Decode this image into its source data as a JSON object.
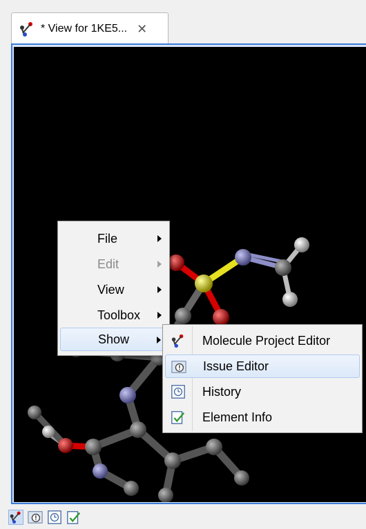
{
  "tab": {
    "title": "* View for 1KE5...",
    "close_glyph": "✕",
    "icon": "molecule-icon"
  },
  "viewer": {
    "description_icon": "3d-molecule-view"
  },
  "context_menu": {
    "items": [
      {
        "label": "File",
        "has_submenu": true,
        "enabled": true
      },
      {
        "label": "Edit",
        "has_submenu": true,
        "enabled": false
      },
      {
        "label": "View",
        "has_submenu": true,
        "enabled": true
      },
      {
        "label": "Toolbox",
        "has_submenu": true,
        "enabled": true
      },
      {
        "label": "Show",
        "has_submenu": true,
        "enabled": true,
        "highlighted": true
      }
    ]
  },
  "show_submenu": {
    "items": [
      {
        "label": "Molecule Project Editor",
        "icon": "molecule-icon"
      },
      {
        "label": "Issue Editor",
        "icon": "issue-icon",
        "highlighted": true
      },
      {
        "label": "History",
        "icon": "history-icon"
      },
      {
        "label": "Element Info",
        "icon": "element-info-icon"
      }
    ]
  },
  "bottom_bar": {
    "icons": [
      "molecule-icon",
      "issue-icon",
      "history-icon",
      "element-info-icon"
    ]
  },
  "colors": {
    "accent": "#3b7bd9",
    "viewer_background": "#000000",
    "atom_carbon": "#6e6e6e",
    "atom_nitrogen": "#7b7bd6",
    "atom_oxygen": "#d40000",
    "atom_sulfur": "#e6e020",
    "atom_hydrogen": "#d8d8d8"
  }
}
